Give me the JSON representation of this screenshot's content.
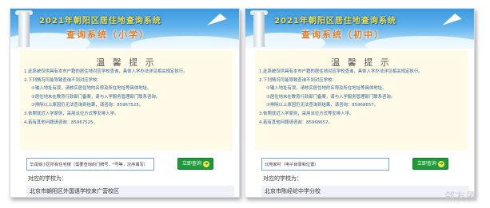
{
  "panels": [
    {
      "banner": {
        "title": "2021年朝阳区居住地查询系统",
        "subtitle": "查询系统（小学）"
      },
      "notice": {
        "title": "温 馨 提 示",
        "lines": [
          "1.此系统仅供具有本市户籍的居住地对应学校查询，具体入学办法详见相关规定执行。",
          "2.下列情况可能导致查询不到对应学校：",
          "①输入地址有误，请核实居住地的名称及所在地址等具体地址。",
          "②居住地未在教育行政部门备案，请与入学服务管理部门联系咨询。",
          "③排除以上原因仍无法查询到结果，请咨询：85967525。",
          "3.依照就近入学原则，采用派位方式等安排入学。",
          "4.若有其他问题请咨询：85967525。"
        ]
      },
      "query": {
        "input_value": "华润城小区所有住宅楼（需要查询的门牌号、*号等，次序填写）",
        "button_label": "立即查询"
      },
      "result": {
        "label": "对应的学校为：",
        "value": "北京市朝阳区外国语学校来广营校区"
      }
    },
    {
      "banner": {
        "title": "2021年朝阳区居住地查询系统",
        "subtitle": "查询系统（初中）"
      },
      "notice": {
        "title": "温 馨 提 示",
        "lines": [
          "1.此系统仅供具有本市户籍的居住地对应学校查询，具体入学办法详见相关规定执行。",
          "2.下列情况可能导致查询不到对应学校：",
          "①输入地址有误，请核实居住地的名称及所在地址等具体地址。",
          "②居住地未在教育行政部门备案，请与入学服务管理部门联系咨询。",
          "③排除以上原因仍无法查询到结果，请咨询：85968657。",
          "3.依照就近入学原则，采用派位方式等安排入学。",
          "4.若有其他问题请咨询：85968657。"
        ]
      },
      "query": {
        "input_value": "北苑家村（电子目录和位置）",
        "button_label": "立即查询"
      },
      "result": {
        "label": "对应的学校为：",
        "value": "北京市陈经纶中学分校"
      }
    }
  ],
  "watermark": "邻友圈"
}
